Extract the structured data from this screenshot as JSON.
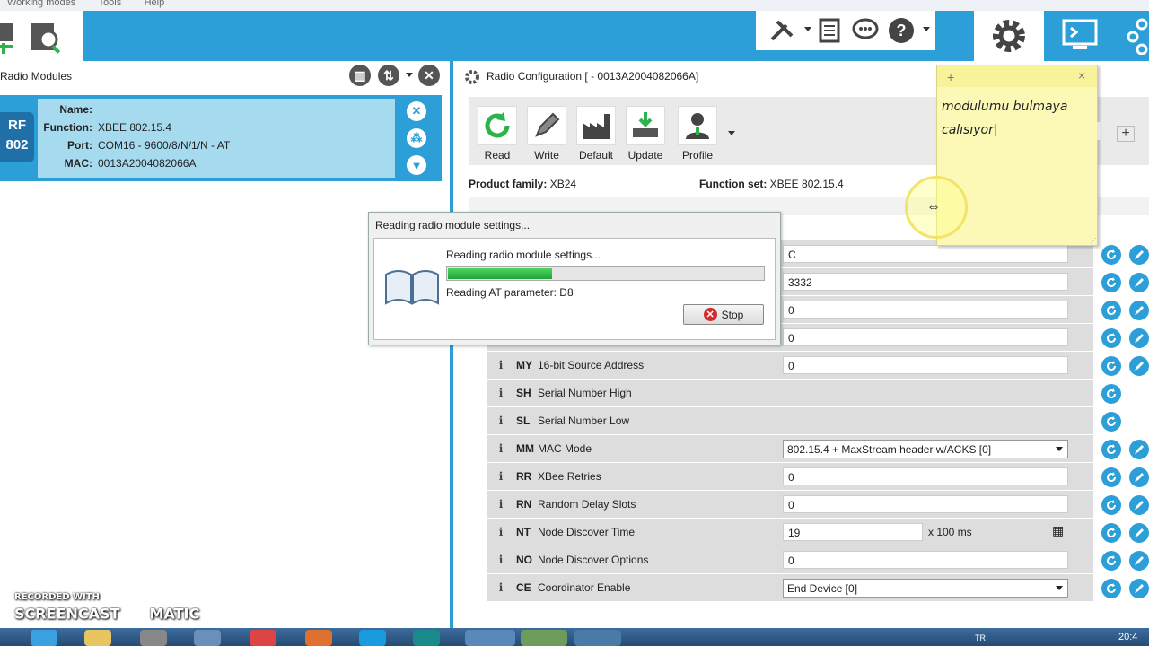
{
  "menu": {
    "items": [
      "Working modes",
      "Tools",
      "Help"
    ]
  },
  "left_panel": {
    "title": "Radio Modules"
  },
  "device": {
    "logo": "802",
    "name_label": "Name:",
    "name_value": "",
    "function_label": "Function:",
    "function_value": "XBEE 802.15.4",
    "port_label": "Port:",
    "port_value": "COM16 - 9600/8/N/1/N - AT",
    "mac_label": "MAC:",
    "mac_value": "0013A2004082066A"
  },
  "right_panel": {
    "title": "Radio Configuration [ - 0013A2004082066A]",
    "actions": [
      {
        "label": "Read"
      },
      {
        "label": "Write"
      },
      {
        "label": "Default"
      },
      {
        "label": "Update"
      },
      {
        "label": "Profile"
      }
    ],
    "product_family_label": "Product family:",
    "product_family_value": "XB24",
    "function_set_label": "Function set:",
    "function_set_value": "XBEE 802.15.4"
  },
  "params": [
    {
      "code": "",
      "desc": "",
      "value": "C"
    },
    {
      "code": "",
      "desc": "",
      "value": "3332"
    },
    {
      "code": "",
      "desc": "",
      "value": "0"
    },
    {
      "code": "",
      "desc": "",
      "value": "0"
    },
    {
      "code": "MY",
      "desc": "16-bit Source Address",
      "value": "0"
    },
    {
      "code": "SH",
      "desc": "Serial Number High",
      "value": ""
    },
    {
      "code": "SL",
      "desc": "Serial Number Low",
      "value": ""
    },
    {
      "code": "MM",
      "desc": "MAC Mode",
      "value": "802.15.4 + MaxStream header w/ACKS [0]"
    },
    {
      "code": "RR",
      "desc": "XBee Retries",
      "value": "0"
    },
    {
      "code": "RN",
      "desc": "Random Delay Slots",
      "value": "0"
    },
    {
      "code": "NT",
      "desc": "Node Discover Time",
      "value": "19",
      "unit": "x 100 ms"
    },
    {
      "code": "NO",
      "desc": "Node Discover Options",
      "value": "0"
    },
    {
      "code": "CE",
      "desc": "Coordinator Enable",
      "value": "End Device [0]"
    }
  ],
  "dialog": {
    "title": "Reading radio module settings...",
    "message": "Reading radio module settings...",
    "param": "Reading AT parameter: D8",
    "progress": 0.33,
    "stop_label": "Stop"
  },
  "sticky": {
    "add": "+",
    "close": "×",
    "text_line1": "modulumu bulmaya",
    "text_line2": "calısıyor"
  },
  "watermark": {
    "line1": "RECORDED WITH",
    "line2": "SCREENCAST",
    "line3": "MATIC"
  },
  "taskbar": {
    "lang": "TR",
    "clock": "20:4"
  },
  "colors": {
    "accent": "#2d9fd8",
    "card": "#a6dbef",
    "progress": "#21a33a"
  }
}
